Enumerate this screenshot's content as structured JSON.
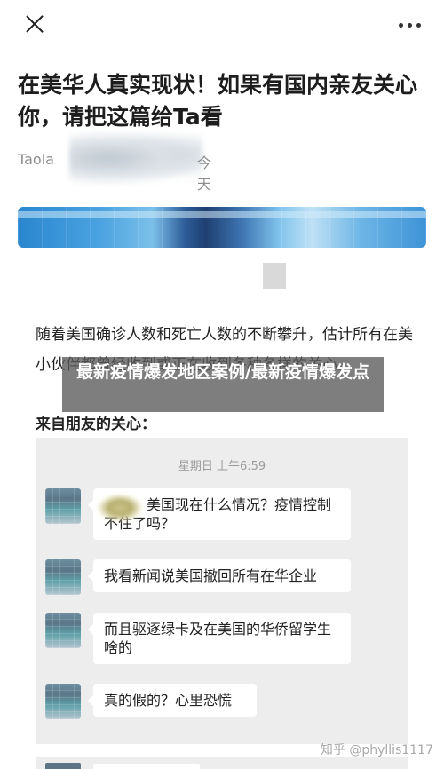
{
  "article": {
    "title": "在美华人真实现状！如果有国内亲友关心你，请把这篇给Ta看",
    "author": "Taola",
    "date": "今天",
    "paragraph": "随着美国确诊人数和死亡人数的不断攀升，估计所有在美小伙伴都曾经收到或正在收到各种各样的关心。",
    "subheading": "来自朋友的关心："
  },
  "overlay": {
    "text": "最新疫情爆发地区案例/最新疫情爆发点"
  },
  "chat": {
    "timestamp": "星期日 上午6:59",
    "messages": [
      {
        "text": "美国现在什么情况？疫情控制不住了吗？"
      },
      {
        "text": "我看新闻说美国撤回所有在华企业"
      },
      {
        "text": "而且驱逐绿卡及在美国的华侨留学生啥的"
      },
      {
        "text": "真的假的？心里恐慌"
      }
    ]
  },
  "watermark": "知乎 @phyllis1117",
  "icons": {
    "close": "close-icon",
    "more": "more-icon"
  },
  "colors": {
    "chat_bg": "#ededed",
    "overlay": "#5a5a5a",
    "meta_text": "#8d8d8d"
  }
}
